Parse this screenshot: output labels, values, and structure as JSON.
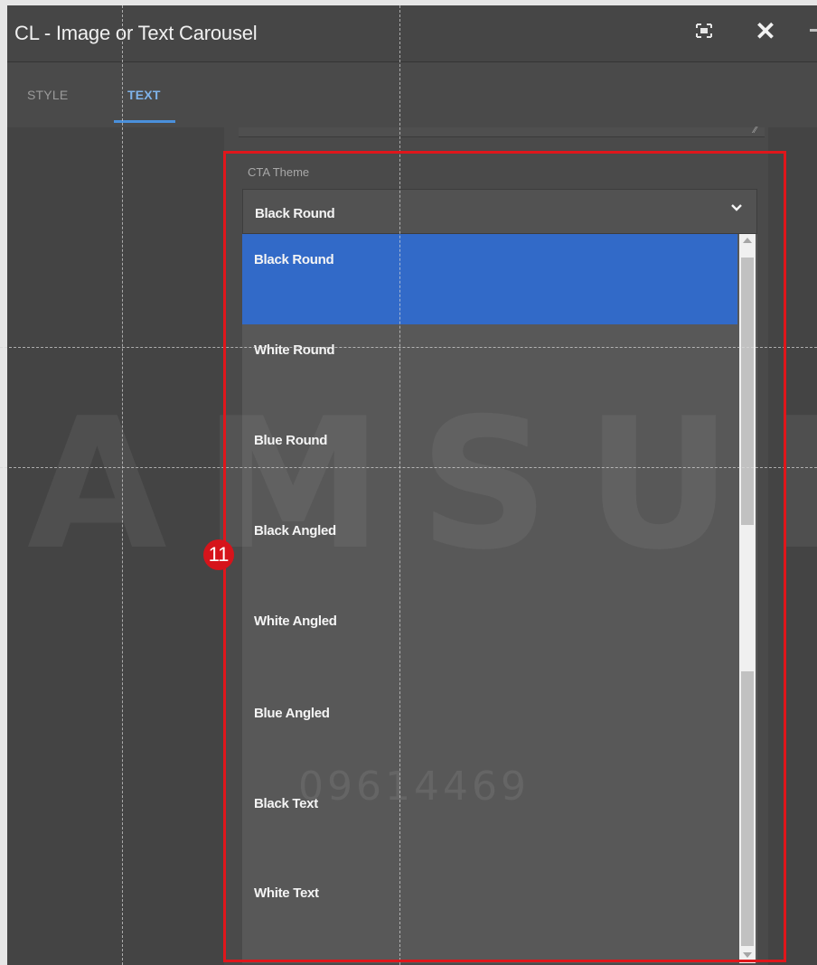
{
  "dialog": {
    "title": "CL - Image or Text Carousel",
    "actions": {
      "fullscreen_icon": "fullscreen-icon",
      "close_icon": "close-icon"
    }
  },
  "tabs": [
    {
      "label": "STYLE",
      "active": false
    },
    {
      "label": "TEXT",
      "active": true
    }
  ],
  "cta_theme": {
    "label": "CTA Theme",
    "selected": "Black Round",
    "options": [
      "Black Round",
      "White Round",
      "Blue Round",
      "Black Angled",
      "White Angled",
      "Blue Angled",
      "Black Text",
      "White Text"
    ]
  },
  "annotation": {
    "badge": "11"
  },
  "watermark": {
    "main": "AMSUN",
    "sub": "09614469"
  },
  "colors": {
    "accent": "#326ac8",
    "tab_active": "#7fb3ea",
    "annotation": "#e0161b"
  }
}
